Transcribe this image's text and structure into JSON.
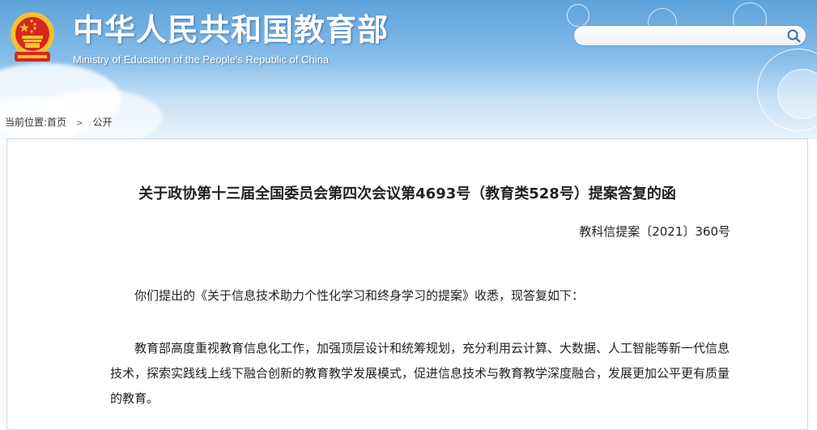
{
  "header": {
    "site_title": "中华人民共和国教育部",
    "site_subtitle": "Ministry of Education of the People's Republic of China",
    "search": {
      "placeholder": "",
      "value": ""
    },
    "icons": {
      "emblem": "national-emblem-icon",
      "search": "search-icon"
    }
  },
  "breadcrumb": {
    "prefix": "当前位置:",
    "items": [
      {
        "label": "首页"
      },
      {
        "label": "公开"
      }
    ],
    "separator": ">"
  },
  "document": {
    "title": "关于政协第十三届全国委员会第四次会议第4693号（教育类528号）提案答复的函",
    "number": "教科信提案〔2021〕360号",
    "paragraphs": [
      "你们提出的《关于信息技术助力个性化学习和终身学习的提案》收悉，现答复如下：",
      "教育部高度重视教育信息化工作，加强顶层设计和统筹规划，充分利用云计算、大数据、人工智能等新一代信息技术，探索实践线上线下融合创新的教育教学发展模式，促进信息技术与教育教学深度融合，发展更加公平更有质量的教育。"
    ]
  },
  "colors": {
    "header_blue": "#5ea2db",
    "emblem_red": "#d8261b",
    "emblem_gold": "#f2c230",
    "text": "#222222",
    "border": "#cfd6de"
  }
}
